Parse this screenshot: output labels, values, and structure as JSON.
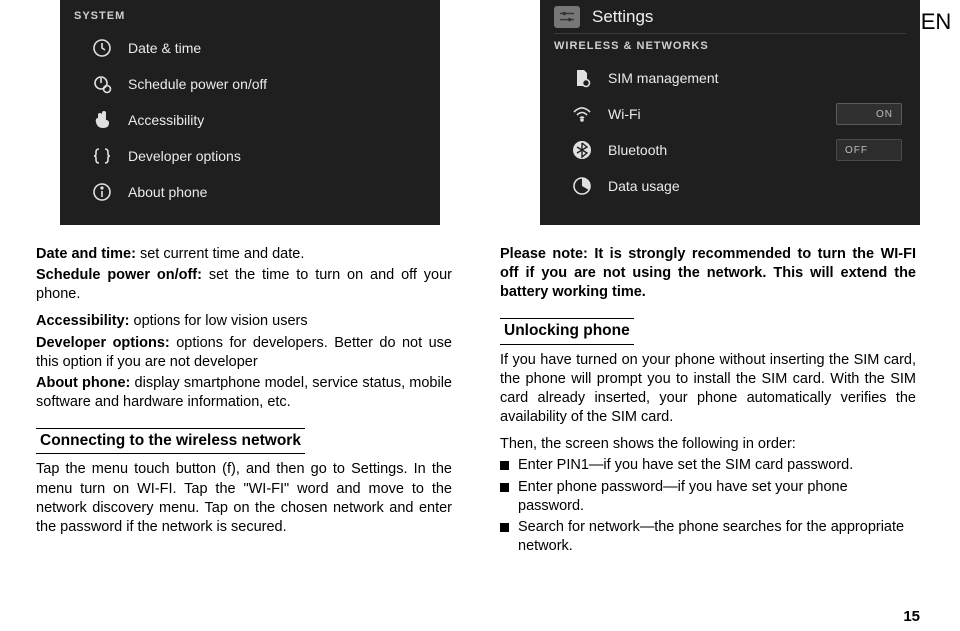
{
  "lang": "EN",
  "page_number": "15",
  "left_panel": {
    "section": "SYSTEM",
    "items": [
      {
        "label": "Date & time"
      },
      {
        "label": "Schedule power on/off"
      },
      {
        "label": "Accessibility"
      },
      {
        "label": "Developer options"
      },
      {
        "label": "About phone"
      }
    ]
  },
  "right_panel": {
    "title": "Settings",
    "section": "WIRELESS & NETWORKS",
    "items": [
      {
        "label": "SIM management",
        "toggle": null
      },
      {
        "label": "Wi-Fi",
        "toggle": "ON"
      },
      {
        "label": "Bluetooth",
        "toggle": "OFF"
      },
      {
        "label": "Data usage",
        "toggle": null
      }
    ]
  },
  "col_left": {
    "p1_a": "Date and time:",
    "p1_b": " set current time and date.",
    "p2_a": "Schedule power on/off:",
    "p2_b": " set the time to turn on and off your phone.",
    "p3_a": "Accessibility:",
    "p3_b": " options for low vision users",
    "p4_a": "Developer options:",
    "p4_b": " options for developers. Better do not use this option if you are not developer",
    "p5_a": "About phone:",
    "p5_b": " display smartphone model, service status, mobile software and hardware information, etc.",
    "h1": "Connecting to the wireless network",
    "p6": "Tap the menu touch button (f), and then go to Settings. In the menu turn on WI-FI. Tap the \"WI-FI\" word and move to the network discovery menu. Tap on the chosen network and enter the password if the network is secured."
  },
  "col_right": {
    "p1_a": "Please note: It is strongly recommended to turn the WI-FI off if you are not using the network. This will extend the battery working time.",
    "h1": "Unlocking phone",
    "p2": "If you have turned on your phone without inserting the SIM card, the phone will prompt you to install the SIM card. With the SIM card already inserted, your phone automatically verifies the availability of the SIM card.",
    "p3": "Then, the screen shows the following in order:",
    "bullets": [
      "Enter PIN1—if you have set the SIM card password.",
      "Enter phone password—if you have set your phone password.",
      "Search for network—the phone searches for the appropriate network."
    ]
  }
}
